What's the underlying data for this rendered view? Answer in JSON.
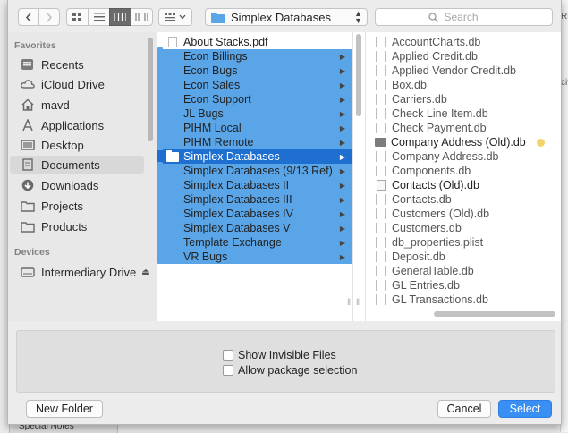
{
  "toolbar": {
    "path_label": "Simplex Databases",
    "search_placeholder": "Search"
  },
  "sidebar": {
    "favorites_header": "Favorites",
    "favorites": [
      {
        "label": "Recents",
        "icon": "recents-icon"
      },
      {
        "label": "iCloud Drive",
        "icon": "cloud-icon"
      },
      {
        "label": "mavd",
        "icon": "home-icon"
      },
      {
        "label": "Applications",
        "icon": "applications-icon"
      },
      {
        "label": "Desktop",
        "icon": "desktop-icon"
      },
      {
        "label": "Documents",
        "icon": "document-icon"
      },
      {
        "label": "Downloads",
        "icon": "download-icon"
      },
      {
        "label": "Projects",
        "icon": "folder-icon"
      },
      {
        "label": "Products",
        "icon": "folder-icon"
      }
    ],
    "selected": "Documents",
    "devices_header": "Devices",
    "devices": [
      {
        "label": "Intermediary Drive",
        "icon": "drive-icon",
        "eject": "⏏"
      }
    ]
  },
  "column1": {
    "items": [
      {
        "label": "About Stacks.pdf",
        "kind": "document"
      },
      {
        "label": "Econ Billings",
        "kind": "folder"
      },
      {
        "label": "Econ Bugs",
        "kind": "folder"
      },
      {
        "label": "Econ Sales",
        "kind": "folder"
      },
      {
        "label": "Econ Support",
        "kind": "folder"
      },
      {
        "label": "JL Bugs",
        "kind": "folder"
      },
      {
        "label": "PIHM Local",
        "kind": "folder"
      },
      {
        "label": "PIHM Remote",
        "kind": "folder"
      },
      {
        "label": "Simplex Databases",
        "kind": "folder",
        "selected": true
      },
      {
        "label": "Simplex Databases (9/13 Ref)",
        "kind": "folder"
      },
      {
        "label": "Simplex Databases II",
        "kind": "folder"
      },
      {
        "label": "Simplex Databases III",
        "kind": "folder"
      },
      {
        "label": "Simplex Databases IV",
        "kind": "folder"
      },
      {
        "label": "Simplex Databases V",
        "kind": "folder"
      },
      {
        "label": "Template Exchange",
        "kind": "folder"
      },
      {
        "label": "VR Bugs",
        "kind": "folder"
      }
    ]
  },
  "column2": {
    "items": [
      {
        "label": "AccountCharts.db",
        "kind": "file"
      },
      {
        "label": "Applied Credit.db",
        "kind": "file"
      },
      {
        "label": "Applied Vendor Credit.db",
        "kind": "file"
      },
      {
        "label": "Box.db",
        "kind": "file"
      },
      {
        "label": "Carriers.db",
        "kind": "file"
      },
      {
        "label": "Check Line Item.db",
        "kind": "file"
      },
      {
        "label": "Check Payment.db",
        "kind": "file"
      },
      {
        "label": "Company Address (Old).db",
        "kind": "db",
        "tag_color": "#f2d36b"
      },
      {
        "label": "Company Address.db",
        "kind": "file"
      },
      {
        "label": "Components.db",
        "kind": "file"
      },
      {
        "label": "Contacts (Old).db",
        "kind": "plist"
      },
      {
        "label": "Contacts.db",
        "kind": "file"
      },
      {
        "label": "Customers (Old).db",
        "kind": "file"
      },
      {
        "label": "Customers.db",
        "kind": "file"
      },
      {
        "label": "db_properties.plist",
        "kind": "file"
      },
      {
        "label": "Deposit.db",
        "kind": "file"
      },
      {
        "label": "GeneralTable.db",
        "kind": "file"
      },
      {
        "label": "GL Entries.db",
        "kind": "file"
      },
      {
        "label": "GL Transactions.db",
        "kind": "file"
      }
    ]
  },
  "options": {
    "show_invisible": "Show Invisible Files",
    "allow_package": "Allow package selection"
  },
  "buttons": {
    "new_folder": "New Folder",
    "cancel": "Cancel",
    "select": "Select"
  },
  "background": {
    "tab_label": "Special Notes",
    "right_fragments": [
      "Ri",
      "cif"
    ]
  },
  "colors": {
    "accent": "#1f6fd1",
    "select_button": "#3a8ff5",
    "folder": "#5aa5e8",
    "tag": "#f2d36b"
  }
}
